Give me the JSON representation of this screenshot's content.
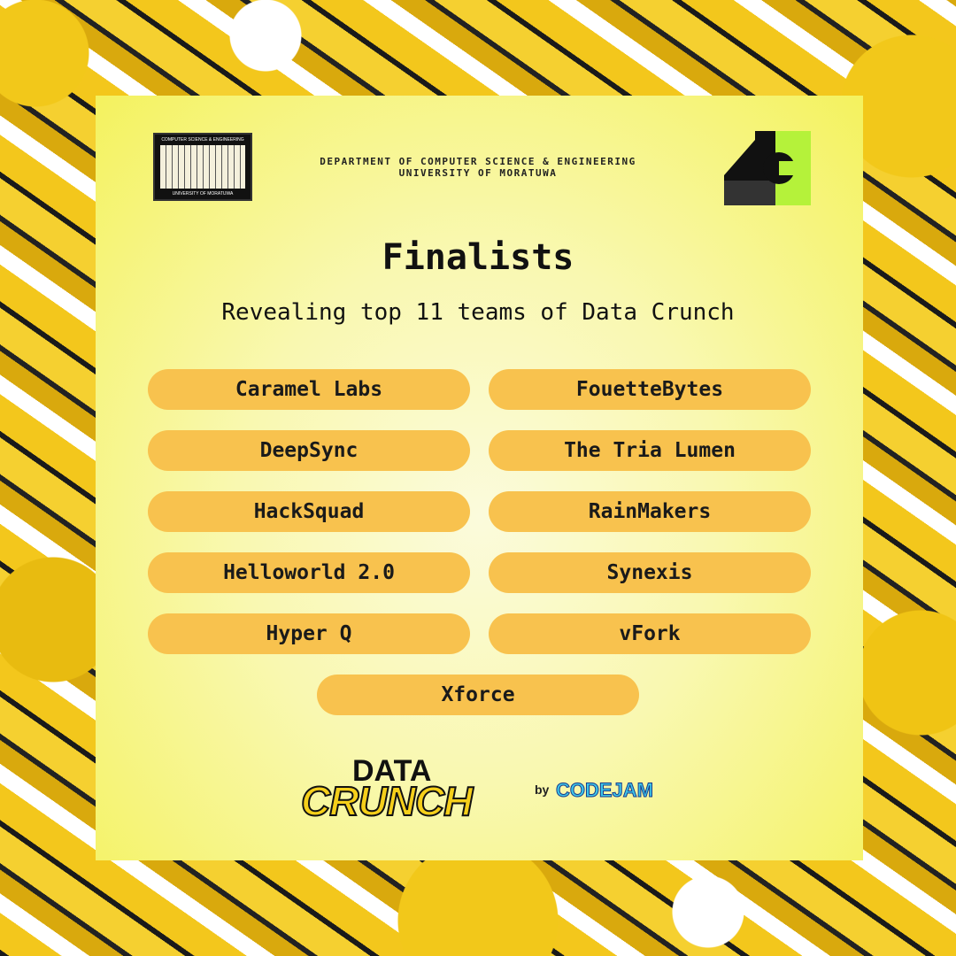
{
  "header": {
    "uom_logo_text_top": "COMPUTER SCIENCE & ENGINEERING",
    "uom_logo_text_bottom": "UNIVERSITY OF MORATUWA",
    "department_line1": "DEPARTMENT OF COMPUTER SCIENCE & ENGINEERING",
    "department_line2": "UNIVERSITY OF MORATUWA"
  },
  "title": "Finalists",
  "subtitle": "Revealing top 11 teams of Data Crunch",
  "teams": [
    "Caramel Labs",
    "FouetteBytes",
    "DeepSync",
    "The Tria Lumen",
    "HackSquad",
    "RainMakers",
    "Helloworld 2.0",
    "Synexis",
    "Hyper Q",
    "vFork",
    "Xforce"
  ],
  "footer": {
    "logo_data": "DATA",
    "logo_crunch": "CRUNCH",
    "by": "by",
    "organizer": "CODEJAM"
  },
  "colors": {
    "pill": "#f8c24e",
    "panel": "#f4f25e",
    "accent_green": "#b5f23a"
  }
}
